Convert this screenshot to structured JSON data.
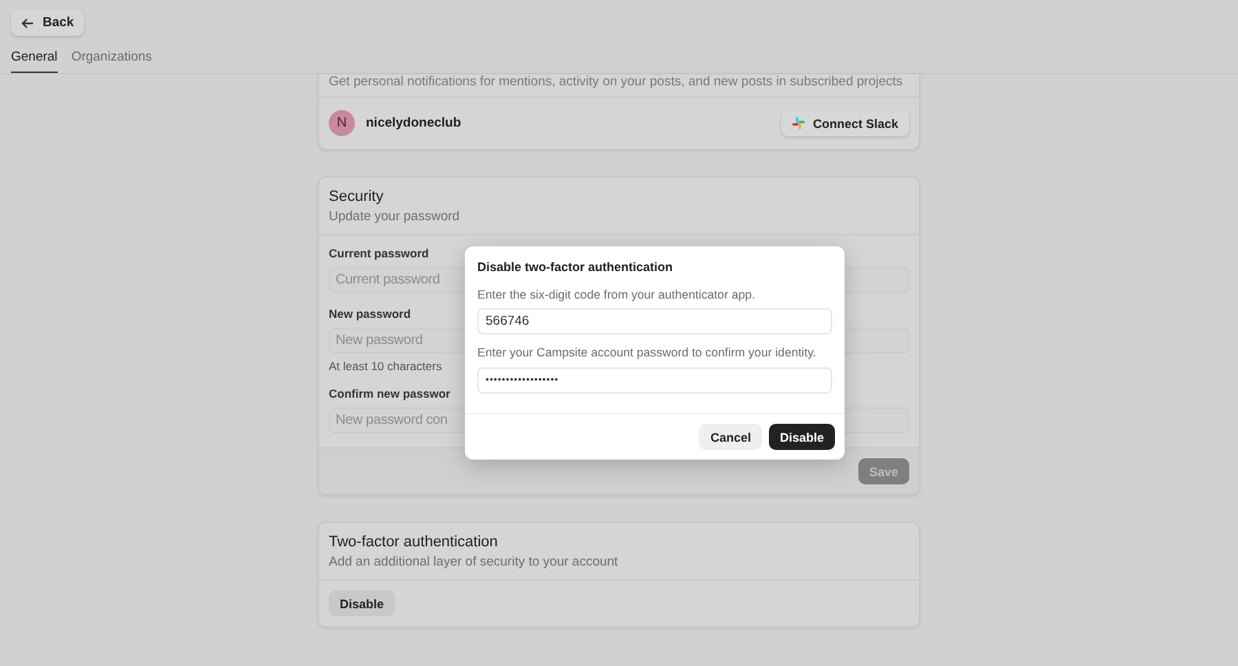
{
  "header": {
    "back_button": "Back",
    "tabs": [
      {
        "label": "General",
        "selected": true
      },
      {
        "label": "Organizations",
        "selected": false
      }
    ]
  },
  "notifications_card": {
    "description": "Get personal notifications for mentions, activity on your posts, and new posts in subscribed projects",
    "account": {
      "avatar": "N",
      "name": "nicelydoneclub"
    },
    "connect_button": "Connect Slack"
  },
  "security_card": {
    "title": "Security",
    "subtitle": "Update your password",
    "fields": [
      {
        "label": "Current password",
        "placeholder": "Current password"
      },
      {
        "label": "New password",
        "placeholder": "New password",
        "hint": "At least 10 characters"
      },
      {
        "label": "Confirm new passwor",
        "placeholder": "New password con"
      }
    ],
    "save_button": {
      "label": "Save",
      "disabled": true
    }
  },
  "two_factor_card": {
    "title": "Two-factor authentication",
    "subtitle": "Add an additional layer of security to your account",
    "button": "Disable"
  },
  "dialog": {
    "title": "Disable two-factor authentication",
    "fields": [
      {
        "label": "Enter the six-digit code from your authenticator app.",
        "value": "566746",
        "kind": "text"
      },
      {
        "label": "Enter your Campsite account password to confirm your identity.",
        "value": "••••••••••••••••••",
        "kind": "password"
      }
    ],
    "buttons": [
      {
        "label": "Cancel",
        "kind": "secondary"
      },
      {
        "label": "Disable",
        "kind": "primary"
      }
    ]
  }
}
